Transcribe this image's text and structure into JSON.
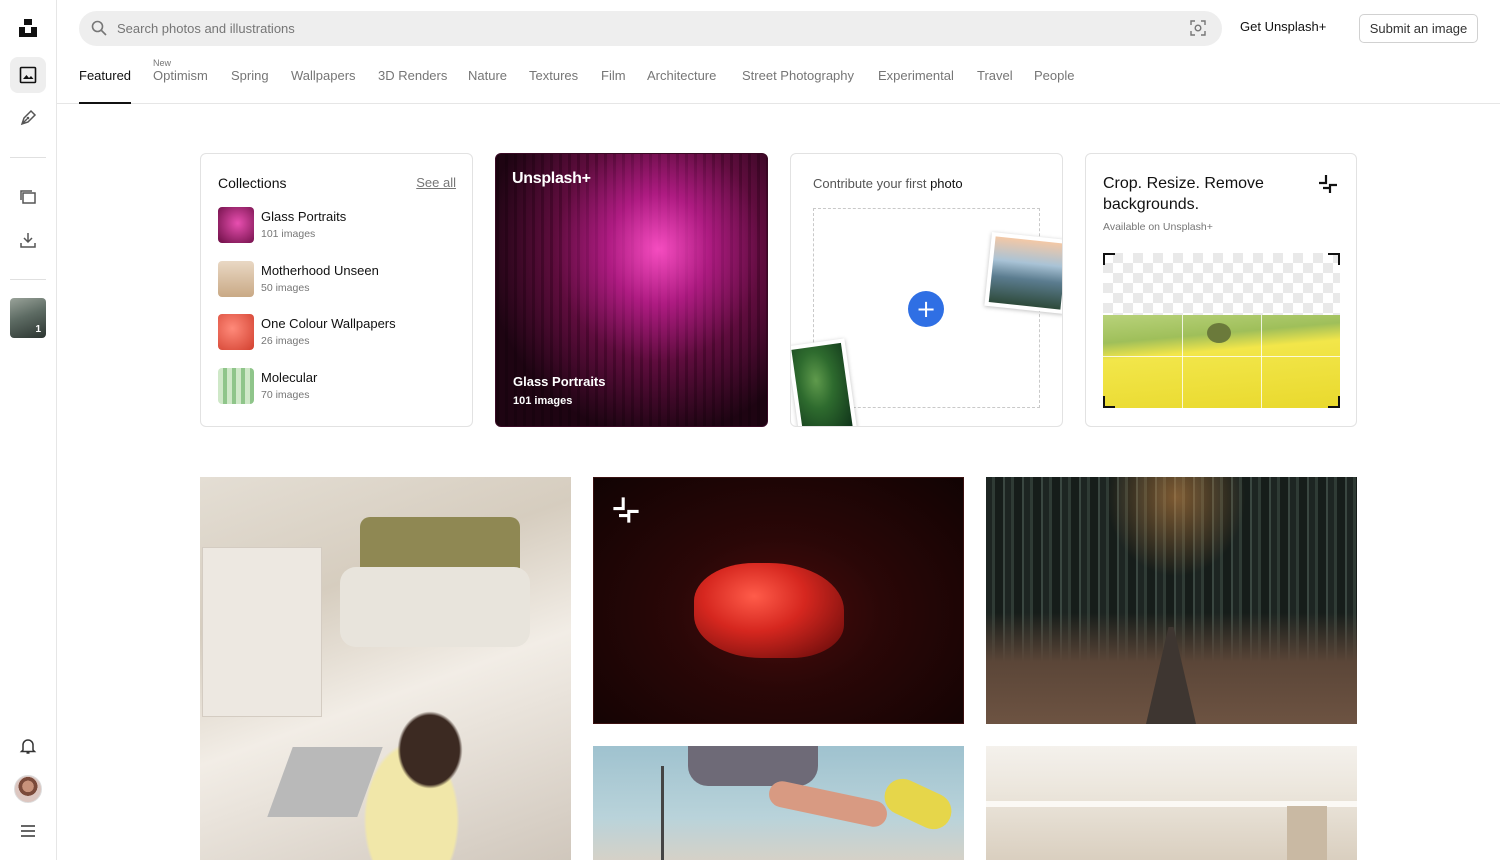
{
  "search": {
    "placeholder": "Search photos and illustrations"
  },
  "header": {
    "get_plus": "Get Unsplash+",
    "submit": "Submit an image"
  },
  "tabs": [
    {
      "label": "Featured",
      "active": true
    },
    {
      "label": "Optimism",
      "badge": "New"
    },
    {
      "label": "Spring"
    },
    {
      "label": "Wallpapers"
    },
    {
      "label": "3D Renders"
    },
    {
      "label": "Nature"
    },
    {
      "label": "Textures"
    },
    {
      "label": "Film"
    },
    {
      "label": "Architecture"
    },
    {
      "label": "Street Photography"
    },
    {
      "label": "Experimental"
    },
    {
      "label": "Travel"
    },
    {
      "label": "People"
    }
  ],
  "sidebar": {
    "icons": [
      "unsplash-logo-icon",
      "image-icon",
      "pen-icon",
      "collections-icon",
      "download-icon",
      "bell-icon",
      "menu-icon"
    ],
    "thumb_count": "1"
  },
  "collections": {
    "title": "Collections",
    "see_all": "See all",
    "items": [
      {
        "name": "Glass Portraits",
        "count": "101 images",
        "color": "#b8227a"
      },
      {
        "name": "Motherhood Unseen",
        "count": "50 images",
        "color": "#d9c2a8"
      },
      {
        "name": "One Colour Wallpapers",
        "count": "26 images",
        "color": "#e0604e"
      },
      {
        "name": "Molecular",
        "count": "70 images",
        "color": "#9ec99a"
      }
    ]
  },
  "featured_collection": {
    "brand": "Unsplash+",
    "name": "Glass Portraits",
    "count": "101 images"
  },
  "contribute": {
    "prefix": "Contribute your first",
    "emphasis": "photo",
    "add": "+"
  },
  "crop": {
    "title": "Crop. Resize. Remove backgrounds.",
    "subtitle": "Available on Unsplash+"
  },
  "colors": {
    "accent_blue": "#2f6fe4",
    "text_primary": "#111111",
    "text_muted": "#767676"
  }
}
